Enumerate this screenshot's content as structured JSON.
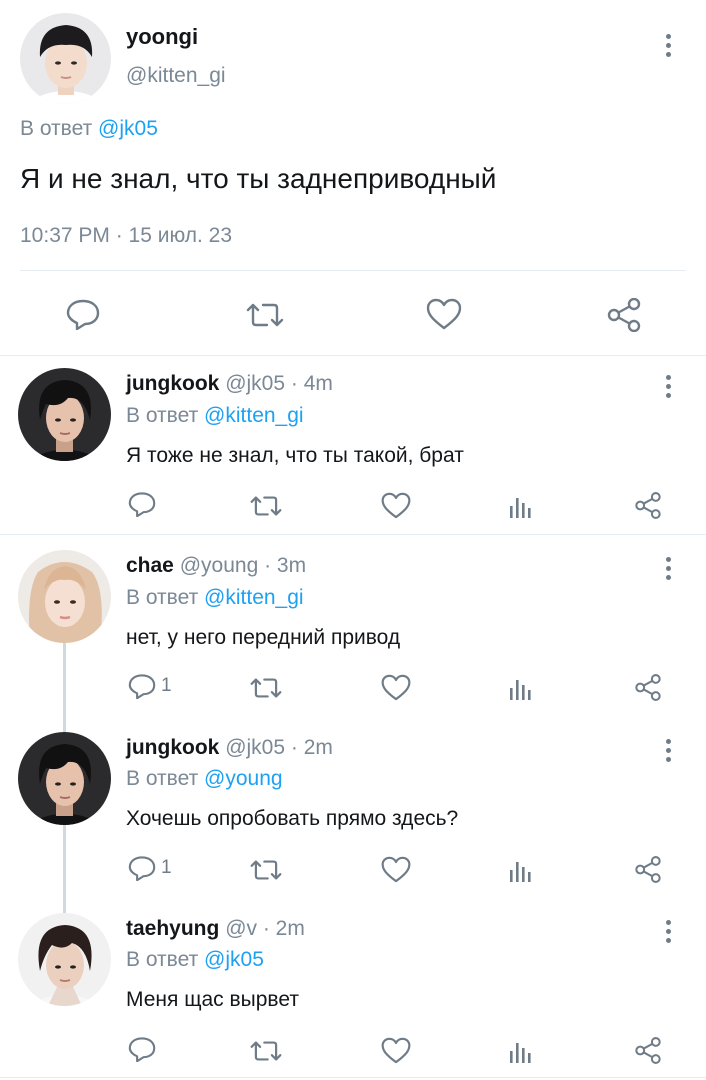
{
  "main_tweet": {
    "display_name": "yoongi",
    "handle": "@kitten_gi",
    "reply_prefix": "В ответ",
    "reply_to": "@jk05",
    "text": "Я и не знал, что ты заднеприводный",
    "timestamp": "10:37 PM · 15 июл. 23"
  },
  "replies": [
    {
      "display_name": "jungkook",
      "meta": "@jk05 · 4m",
      "reply_prefix": "В ответ",
      "reply_to": "@kitten_gi",
      "text": "Я тоже не знал, что ты такой, брат",
      "reply_count": ""
    },
    {
      "display_name": "chae",
      "meta": "@young · 3m",
      "reply_prefix": "В ответ",
      "reply_to": "@kitten_gi",
      "text": "нет, у него передний привод",
      "reply_count": "1"
    },
    {
      "display_name": "jungkook",
      "meta": "@jk05 · 2m",
      "reply_prefix": "В ответ",
      "reply_to": "@young",
      "text": "Хочешь опробовать прямо здесь?",
      "reply_count": "1"
    },
    {
      "display_name": "taehyung",
      "meta": "@v · 2m",
      "reply_prefix": "В ответ",
      "reply_to": "@jk05",
      "text": "Меня щас вырвет",
      "reply_count": ""
    }
  ],
  "icons": {
    "reply": "speech-bubble-icon",
    "retweet": "retweet-icon",
    "like": "heart-icon",
    "analytics": "bar-chart-icon",
    "share": "share-icon",
    "more": "kebab-menu-icon"
  },
  "colors": {
    "link": "#1da1f2",
    "muted": "#7b8895",
    "icon": "#6f7c88",
    "divider": "#e6ecf0"
  }
}
